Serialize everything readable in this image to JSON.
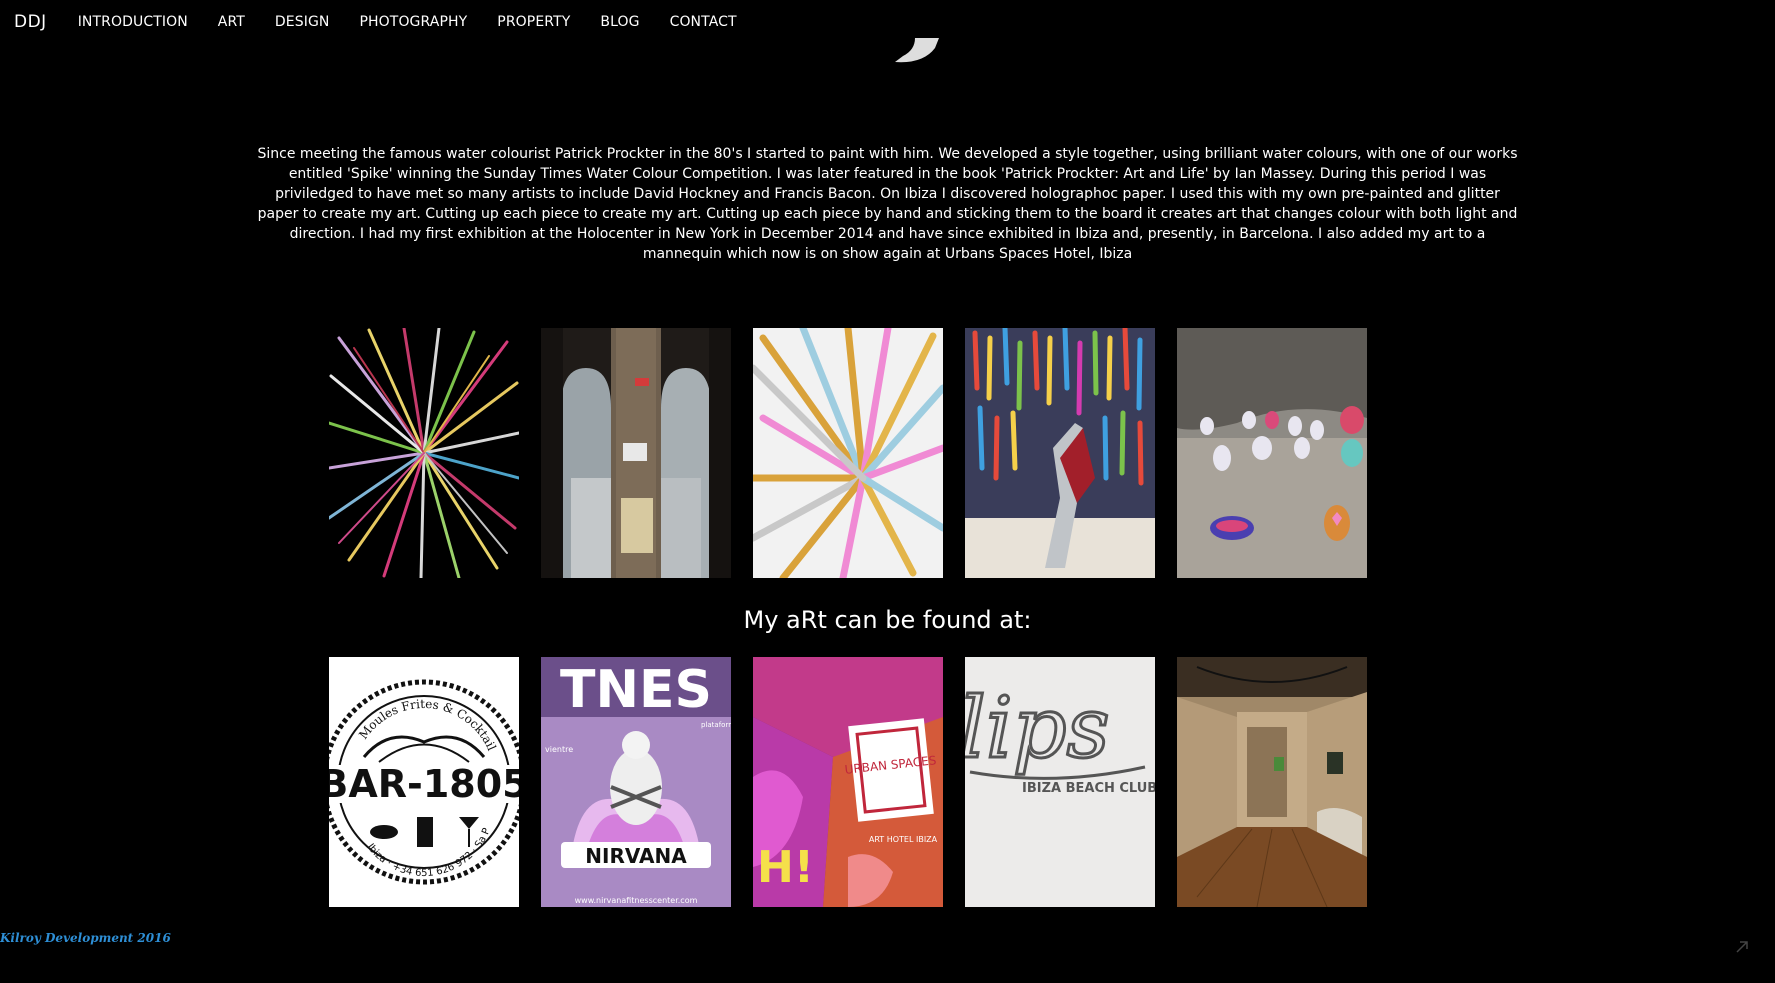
{
  "nav": {
    "brand": "DDJ",
    "items": [
      {
        "label": "INTRODUCTION"
      },
      {
        "label": "ART"
      },
      {
        "label": "DESIGN"
      },
      {
        "label": "PHOTOGRAPHY"
      },
      {
        "label": "PROPERTY"
      },
      {
        "label": "BLOG"
      },
      {
        "label": "CONTACT"
      }
    ]
  },
  "intro": {
    "text": "Since meeting the famous water colourist Patrick Prockter in the 80's I started to paint with him. We developed a style together, using brilliant water colours, with one of our works entitled 'Spike' winning the Sunday Times Water Colour Competition. I was later featured in the book 'Patrick Prockter: Art and Life' by Ian Massey. During this period I was priviledged to have met so many artists to include David Hockney and Francis Bacon. On Ibiza I discovered holographoc paper. I used this with my own pre-painted and glitter paper to create my art. Cutting up each piece to create my art. Cutting up each piece by hand and sticking them to the board it creates art that changes colour with both light and direction. I had my first exhibition at the Holocenter in New York in December 2014 and have since exhibited in Ibiza and, presently, in Barcelona. I also added my art to a mannequin which now is on show again at Urbans Spaces Hotel, Ibiza"
  },
  "found": {
    "heading": "My aRt can be found at:"
  },
  "venues": {
    "bar1805": {
      "top": "Moules Frites & Cocktails",
      "name": "BAR-1805",
      "bottom": "Ibiza · +34 651 626 972 · Sa Penya"
    },
    "nirvana": {
      "big": "TNES",
      "name": "NIRVANA",
      "url": "www.nirvanafitnesscenter.com",
      "side_left": "vientre",
      "side_right": "plataforma POWER maquinas generales"
    },
    "urban": {
      "name": "URBAN SPACES",
      "sub": "ART HOTEL IBIZA"
    },
    "lips": {
      "name": "lips",
      "sub": "IBIZA BEACH CLUB"
    }
  },
  "footer": {
    "text": "Kilroy Development 2016",
    "color": "#2e8fd6"
  },
  "icons": {
    "corner": "arrow-icon"
  }
}
